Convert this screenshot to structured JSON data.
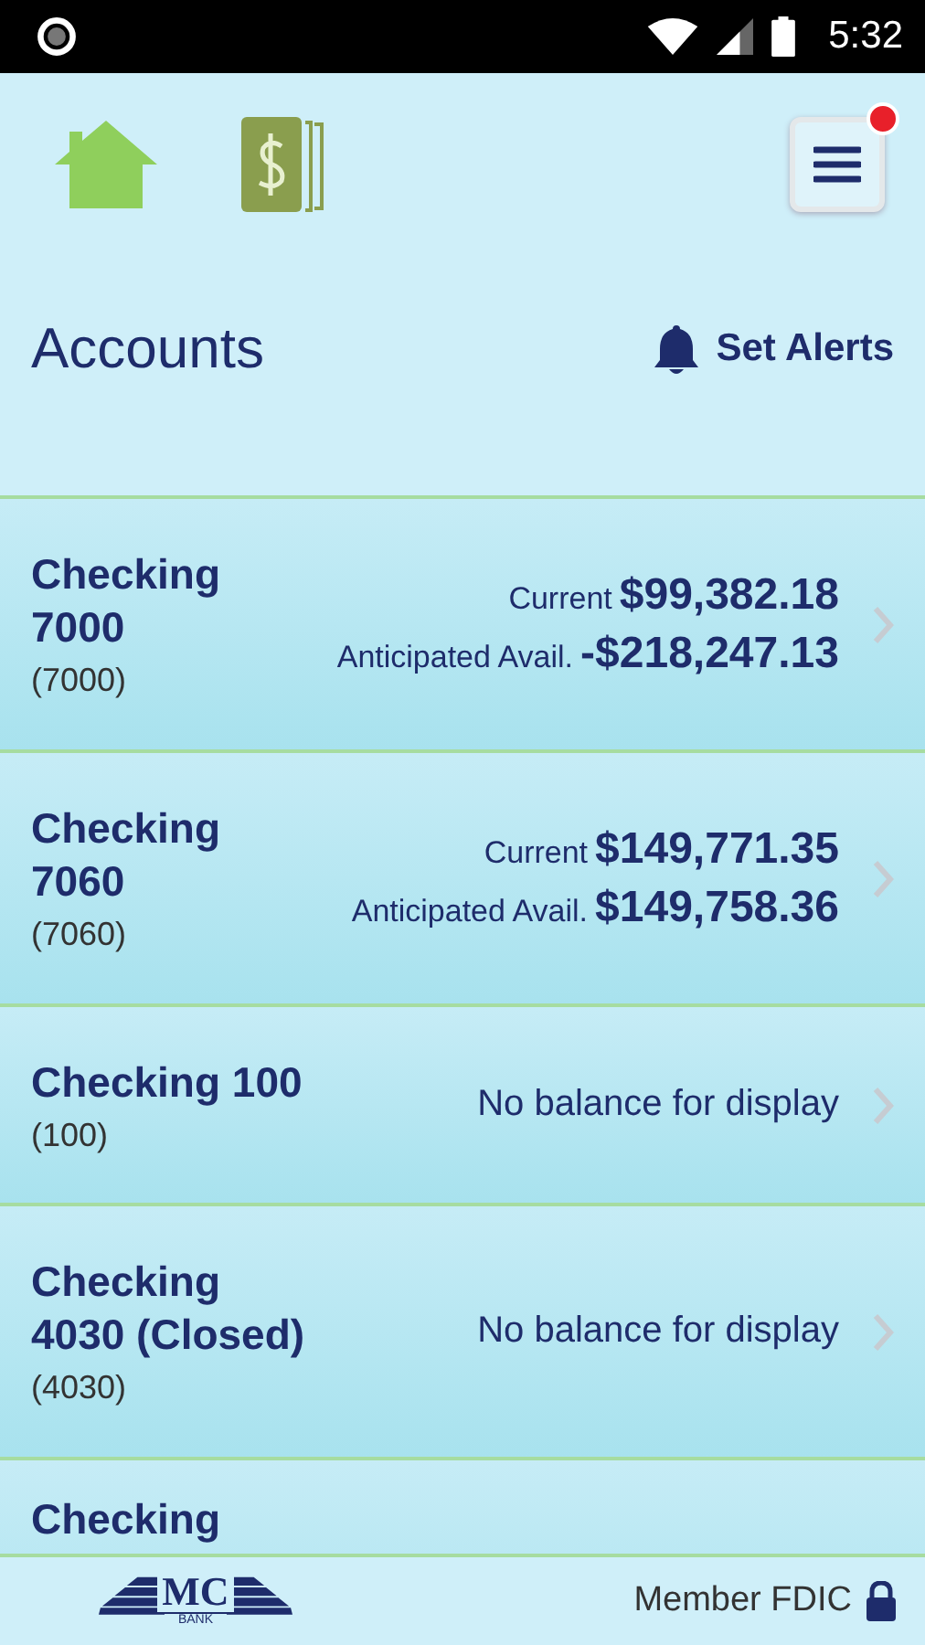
{
  "status_bar": {
    "time": "5:32"
  },
  "header": {
    "menu_notification": true
  },
  "title": "Accounts",
  "alerts_label": "Set Alerts",
  "accounts": [
    {
      "kind": "balances",
      "name": "Checking 7000",
      "number": "(7000)",
      "balances": [
        {
          "label": "Current",
          "amount": "$99,382.18"
        },
        {
          "label": "Anticipated Avail.",
          "amount": "-$218,247.13"
        }
      ]
    },
    {
      "kind": "balances",
      "name": "Checking 7060",
      "number": "(7060)",
      "balances": [
        {
          "label": "Current",
          "amount": "$149,771.35"
        },
        {
          "label": "Anticipated Avail.",
          "amount": "$149,758.36"
        }
      ]
    },
    {
      "kind": "message",
      "name": "Checking 100",
      "number": "(100)",
      "message": "No balance for display"
    },
    {
      "kind": "message",
      "name": "Checking 4030 (Closed)",
      "number": "(4030)",
      "message": "No balance for display"
    },
    {
      "kind": "partial",
      "name": "Checking"
    }
  ],
  "footer": {
    "logo": "MC",
    "logo_sub": "BANK",
    "fdic": "Member FDIC"
  }
}
